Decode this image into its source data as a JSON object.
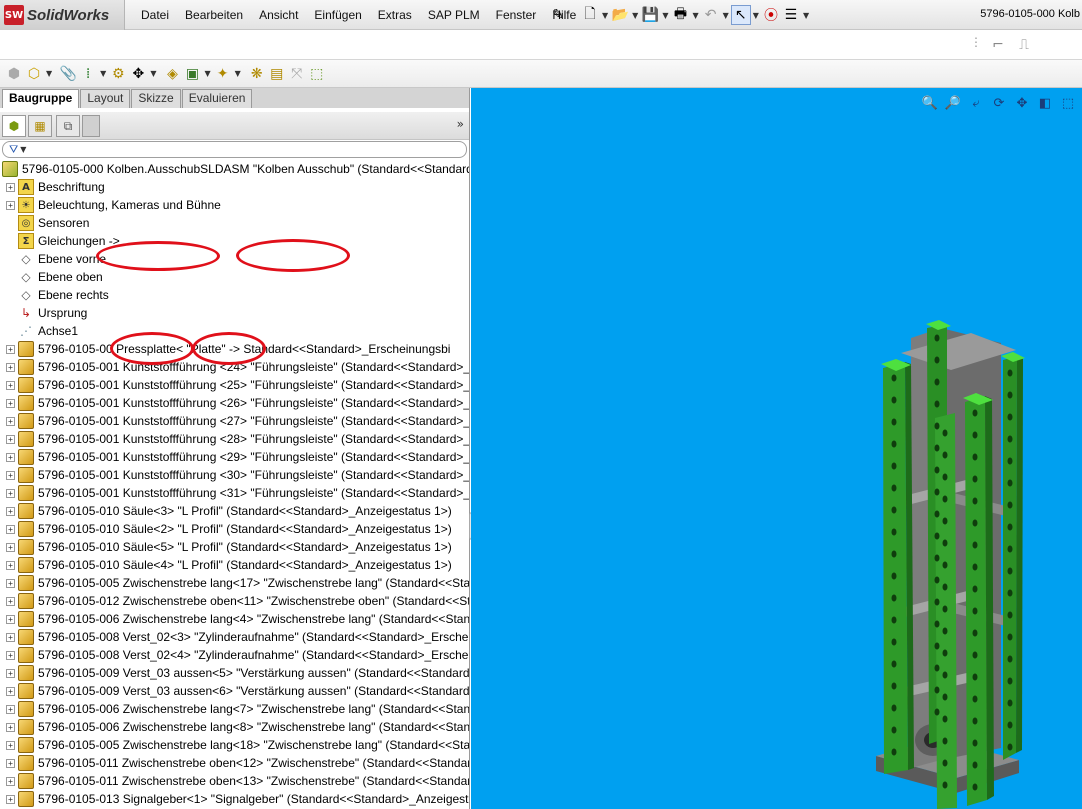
{
  "app": {
    "logo_prefix": "SW",
    "logo_text": "SolidWorks",
    "document_title": "5796-0105-000 Kolb"
  },
  "menu": [
    "Datei",
    "Bearbeiten",
    "Ansicht",
    "Einfügen",
    "Extras",
    "SAP PLM",
    "Fenster",
    "Hilfe"
  ],
  "panel_tabs": [
    {
      "label": "Baugruppe",
      "active": true
    },
    {
      "label": "Layout",
      "active": false
    },
    {
      "label": "Skizze",
      "active": false
    },
    {
      "label": "Evaluieren",
      "active": false
    }
  ],
  "tree": [
    {
      "label": "5796-0105-000 Kolben.AusschubSLDASM \"Kolben Ausschub\" (Standard<<Standard>",
      "icon": "assembly-icon",
      "expander": false,
      "indent": 0
    },
    {
      "label": "Beschriftung",
      "icon": "annotation-folder-icon",
      "expander": true
    },
    {
      "label": "Beleuchtung, Kameras und Bühne",
      "icon": "lights-folder-icon",
      "expander": true
    },
    {
      "label": "Sensoren",
      "icon": "sensor-folder-icon",
      "expander": false
    },
    {
      "label": "Gleichungen ->",
      "icon": "equation-folder-icon",
      "expander": false
    },
    {
      "label": "Ebene vorne",
      "icon": "plane-icon",
      "expander": false
    },
    {
      "label": "Ebene oben",
      "icon": "plane-icon",
      "expander": false
    },
    {
      "label": "Ebene rechts",
      "icon": "plane-icon",
      "expander": false
    },
    {
      "label": "Ursprung",
      "icon": "origin-icon",
      "expander": false
    },
    {
      "label": "Achse1",
      "icon": "axis-icon",
      "expander": false
    },
    {
      "label": "5796-0105-00  Pressplatte<  \"Platte\" -> Standard<<Standard>_Erscheinungsbi",
      "icon": "part-icon",
      "expander": true
    },
    {
      "label": "5796-0105-001 Kunststoffführung <24> \"Führungsleiste\" (Standard<<Standard>_A",
      "icon": "part-icon",
      "expander": true
    },
    {
      "label": "5796-0105-001 Kunststoffführung <25> \"Führungsleiste\" (Standard<<Standard>_A",
      "icon": "part-icon",
      "expander": true
    },
    {
      "label": "5796-0105-001 Kunststoffführung <26> \"Führungsleiste\" (Standard<<Standard>_A",
      "icon": "part-icon",
      "expander": true
    },
    {
      "label": "5796-0105-001 Kunststoffführung <27> \"Führungsleiste\" (Standard<<Standard>_A",
      "icon": "part-icon",
      "expander": true
    },
    {
      "label": "5796-0105-001 Kunststoffführung <28> \"Führungsleiste\" (Standard<<Standard>_A",
      "icon": "part-icon",
      "expander": true
    },
    {
      "label": "5796-0105-001 Kunststoffführung <29> \"Führungsleiste\" (Standard<<Standard>_A",
      "icon": "part-icon",
      "expander": true
    },
    {
      "label": "5796-0105-001 Kunststoffführung <30> \"Führungsleiste\" (Standard<<Standard>_A",
      "icon": "part-icon",
      "expander": true
    },
    {
      "label": "5796-0105-001 Kunststoffführung <31> \"Führungsleiste\" (Standard<<Standard>_A",
      "icon": "part-icon",
      "expander": true
    },
    {
      "label": "5796-0105-010 Säule<3> \"L Profil\" (Standard<<Standard>_Anzeigestatus 1>)",
      "icon": "part-icon",
      "expander": true
    },
    {
      "label": "5796-0105-010 Säule<2> \"L Profil\" (Standard<<Standard>_Anzeigestatus 1>)",
      "icon": "part-icon",
      "expander": true
    },
    {
      "label": "5796-0105-010 Säule<5> \"L Profil\" (Standard<<Standard>_Anzeigestatus 1>)",
      "icon": "part-icon",
      "expander": true
    },
    {
      "label": "5796-0105-010 Säule<4> \"L Profil\" (Standard<<Standard>_Anzeigestatus 1>)",
      "icon": "part-icon",
      "expander": true
    },
    {
      "label": "5796-0105-005 Zwischenstrebe lang<17> \"Zwischenstrebe lang\" (Standard<<Star",
      "icon": "part-icon",
      "expander": true
    },
    {
      "label": "5796-0105-012 Zwischenstrebe oben<11> \"Zwischenstrebe oben\" (Standard<<Sta",
      "icon": "part-icon",
      "expander": true
    },
    {
      "label": "5796-0105-006 Zwischenstrebe lang<4> \"Zwischenstrebe lang\" (Standard<<Stanc",
      "icon": "part-icon",
      "expander": true
    },
    {
      "label": "5796-0105-008 Verst_02<3> \"Zylinderaufnahme\" (Standard<<Standard>_Erschein",
      "icon": "part-icon",
      "expander": true
    },
    {
      "label": "5796-0105-008 Verst_02<4> \"Zylinderaufnahme\" (Standard<<Standard>_Erschein",
      "icon": "part-icon",
      "expander": true
    },
    {
      "label": "5796-0105-009 Verst_03 aussen<5> \"Verstärkung aussen\" (Standard<<Standard>_",
      "icon": "part-icon",
      "expander": true
    },
    {
      "label": "5796-0105-009 Verst_03 aussen<6> \"Verstärkung aussen\" (Standard<<Standard>_",
      "icon": "part-icon",
      "expander": true
    },
    {
      "label": "5796-0105-006 Zwischenstrebe lang<7> \"Zwischenstrebe lang\" (Standard<<Stanc",
      "icon": "part-icon",
      "expander": true
    },
    {
      "label": "5796-0105-006 Zwischenstrebe lang<8> \"Zwischenstrebe lang\" (Standard<<Stanc",
      "icon": "part-icon",
      "expander": true
    },
    {
      "label": "5796-0105-005 Zwischenstrebe lang<18> \"Zwischenstrebe lang\" (Standard<<Star",
      "icon": "part-icon",
      "expander": true
    },
    {
      "label": "5796-0105-011 Zwischenstrebe oben<12> \"Zwischenstrebe\" (Standard<<Standard",
      "icon": "part-icon",
      "expander": true
    },
    {
      "label": "5796-0105-011 Zwischenstrebe oben<13> \"Zwischenstrebe\" (Standard<<Standard",
      "icon": "part-icon",
      "expander": true
    },
    {
      "label": "5796-0105-013 Signalgeber<1> \"Signalgeber\" (Standard<<Standard>_Anzeigestat",
      "icon": "part-icon",
      "expander": true
    }
  ],
  "colors": {
    "viewport_bg": "#00a0f0",
    "highlight_ring": "#e0101a",
    "model_green": "#2f9b2a",
    "model_frame": "#7d7d7d"
  }
}
